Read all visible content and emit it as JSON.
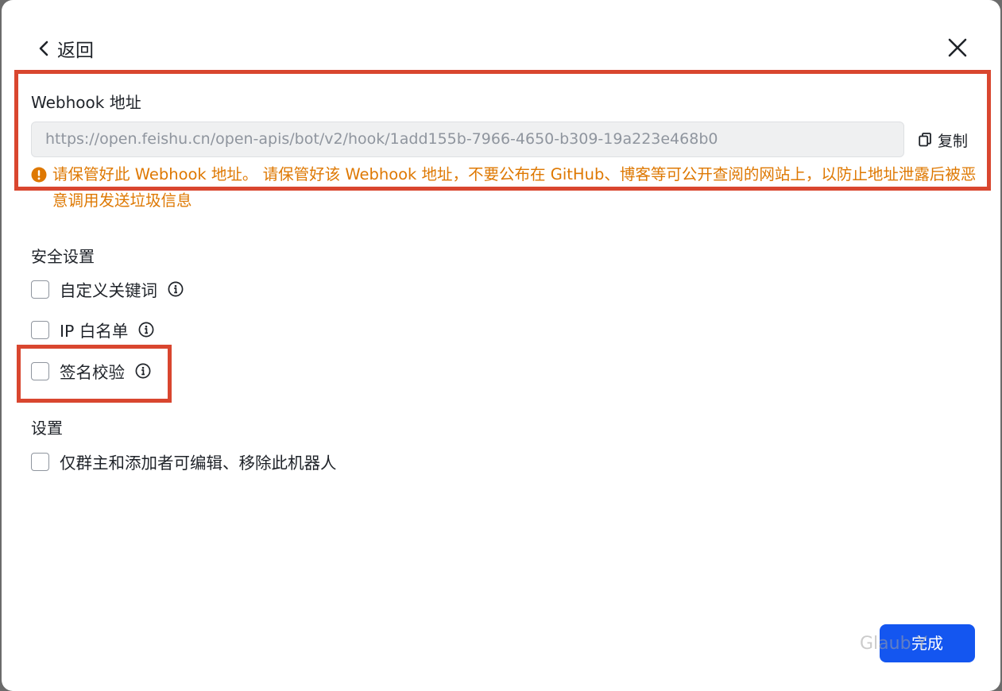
{
  "header": {
    "back_label": "返回",
    "back_icon": "chevron-left-icon",
    "close_icon": "close-icon"
  },
  "webhook": {
    "label": "Webhook 地址",
    "url": "https://open.feishu.cn/open-apis/bot/v2/hook/1add155b-7966-4650-b309-19a223e468b0",
    "copy_label": "复制",
    "copy_icon": "copy-icon",
    "warning_icon": "warning-icon",
    "warning_text": "请保管好此 Webhook 地址。 请保管好该 Webhook 地址，不要公布在 GitHub、博客等可公开查阅的网站上，以防止地址泄露后被恶意调用发送垃圾信息",
    "warning_color": "#de7802"
  },
  "security": {
    "title": "安全设置",
    "options": [
      {
        "label": "自定义关键词",
        "checked": false
      },
      {
        "label": "IP 白名单",
        "checked": false
      },
      {
        "label": "签名校验",
        "checked": false
      }
    ]
  },
  "settings": {
    "title": "设置",
    "options": [
      {
        "label": "仅群主和添加者可编辑、移除此机器人",
        "checked": false
      }
    ]
  },
  "footer": {
    "done_label": "完成",
    "done_color": "#1456f0"
  },
  "watermark": "Glaub  Y",
  "annotation_color": "#d9462f"
}
